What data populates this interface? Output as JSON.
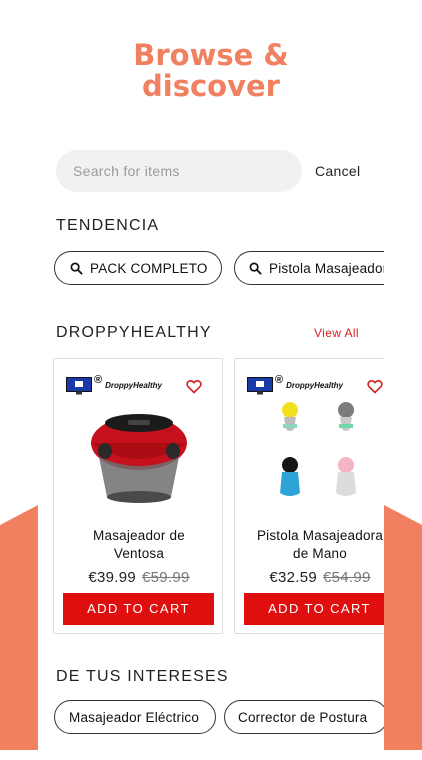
{
  "headline": {
    "line1": "Browse &",
    "line2": "discover"
  },
  "search": {
    "placeholder": "Search for items",
    "cancel_label": "Cancel"
  },
  "trending": {
    "title": "TENDENCIA",
    "chips": [
      {
        "label": "PACK COMPLETO"
      },
      {
        "label": "Pistola Masajeador"
      }
    ]
  },
  "store": {
    "title": "DROPPYHEALTHY",
    "view_all": "View All",
    "brand_name": "DroppyHealthy",
    "brand_reg": "®",
    "products": [
      {
        "name_line1": "Masajeador de",
        "name_line2": "Ventosa",
        "price": "€39.99",
        "old_price": "€59.99",
        "add_to_cart": "ADD TO CART"
      },
      {
        "name_line1": "Pistola Masajeadora",
        "name_line2": "de Mano",
        "price": "€32.59",
        "old_price": "€54.99",
        "add_to_cart": "ADD TO CART"
      }
    ]
  },
  "interests": {
    "title": "DE TUS INTERESES",
    "chips": [
      {
        "label": "Masajeador Eléctrico"
      },
      {
        "label": "Corrector de Postura"
      }
    ]
  },
  "colors": {
    "accent": "#f08060",
    "cta": "#e00f0f",
    "link": "#d4221e",
    "heart": "#d4221e"
  },
  "icons": {
    "search": "search-icon",
    "heart": "heart-icon",
    "brand": "monitor-cart-icon"
  }
}
